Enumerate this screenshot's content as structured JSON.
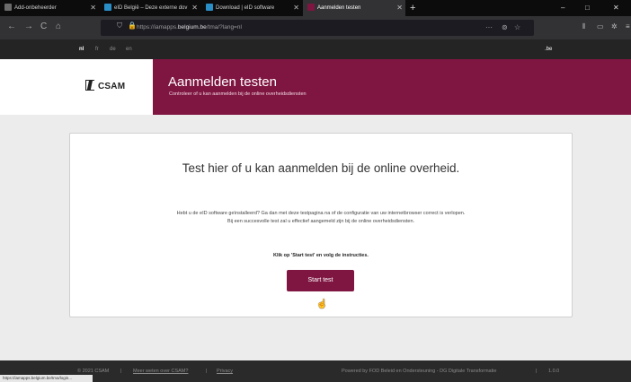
{
  "browser": {
    "tabs": [
      {
        "label": "Add-onbeheerder",
        "color": "#6b6b6b"
      },
      {
        "label": "eID België – Deze externe dov",
        "color": "#2a8ec7"
      },
      {
        "label": "Download | eID software",
        "color": "#2a8ec7"
      },
      {
        "label": "Aanmelden testen",
        "color": "#7f1541"
      }
    ],
    "active_tab_index": 3,
    "new_tab_label": "+",
    "window_controls": [
      "–",
      "□",
      "✕"
    ],
    "url": {
      "prefix": "https://iamapps.",
      "domain": "belgium.be",
      "suffix": "/tma/?lang=nl"
    },
    "url_more": "···",
    "nav": {
      "back": "←",
      "forward": "→",
      "reload": "C",
      "home": "⌂"
    }
  },
  "site_bar": {
    "languages": [
      "nl",
      "fr",
      "de",
      "en"
    ],
    "current_language": "nl",
    "be_label": ".be"
  },
  "header": {
    "logo_text": "CSAM",
    "title": "Aanmelden testen",
    "subtitle": "Controleer of u kan aanmelden bij de online overheidsdiensten",
    "accent_color": "#7f1541"
  },
  "main": {
    "heading": "Test hier of u kan aanmelden bij de online overheid.",
    "description": "Hebt u de eID software geïnstalleerd? Ga dan met deze testpagina na of de configuratie van uw internetbrowser correct is verlopen. Bij een succesvolle test zal u effectief aangemeld zijn bij de online overheidsdiensten.",
    "instruction": "Klik op 'Start test' en volg de instructies.",
    "start_button": "Start test"
  },
  "footer": {
    "copyright": "© 2021 CSAM",
    "more_link": "Meer weten over CSAM?",
    "privacy_link": "Privacy",
    "separator": "|",
    "powered_by": "Powered by FOD Beleid en Ondersteuning - DG Digitale Transformatie",
    "version": "1.0.0"
  },
  "status_bar": "https://iamapps.belgium.be/tma/login..."
}
